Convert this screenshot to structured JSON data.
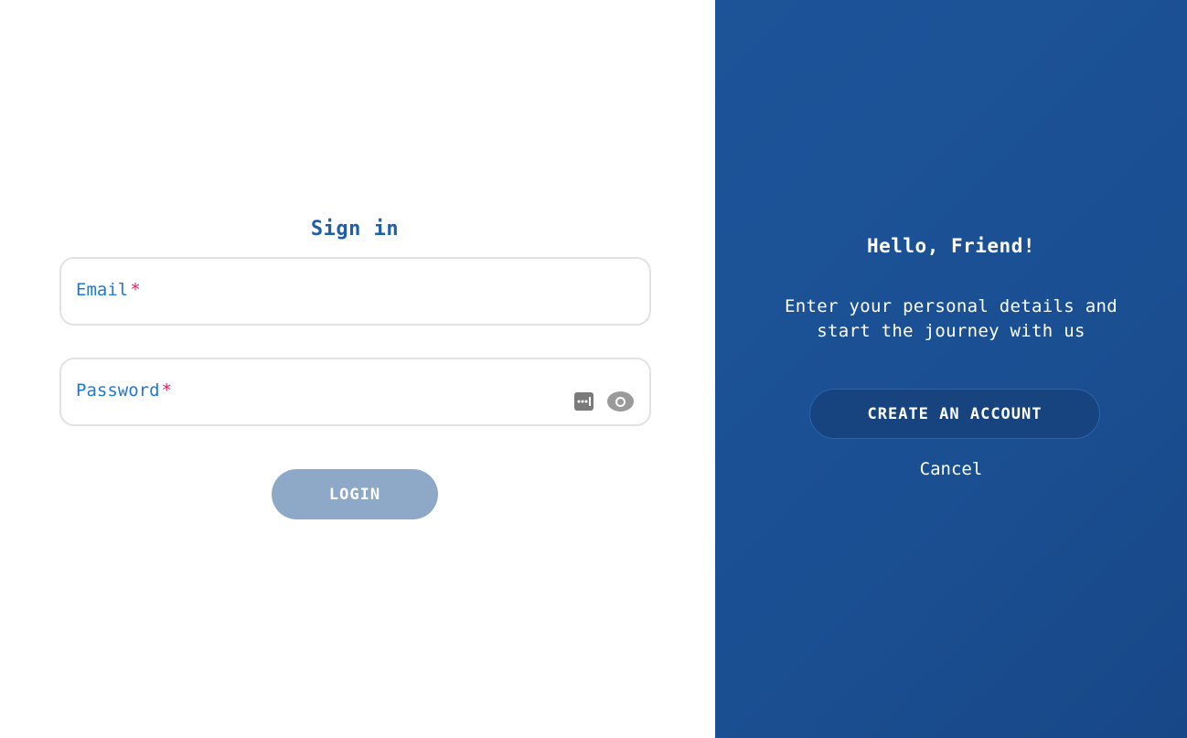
{
  "signin": {
    "title": "Sign in",
    "email": {
      "label": "Email",
      "required_mark": "*",
      "value": ""
    },
    "password": {
      "label": "Password",
      "required_mark": "*",
      "value": "",
      "toggle_icon": "eye-icon",
      "manager_icon": "password-manager-icon"
    },
    "login_label": "LOGIN"
  },
  "signup": {
    "greeting": "Hello, Friend!",
    "message": "Enter your personal details and start the journey with us",
    "create_label": "CREATE AN ACCOUNT",
    "cancel_label": "Cancel"
  },
  "colors": {
    "accent": "#1e78d7",
    "panel": "#1a4f92",
    "required": "#e0245e",
    "login_button": "#8ea9c8"
  }
}
